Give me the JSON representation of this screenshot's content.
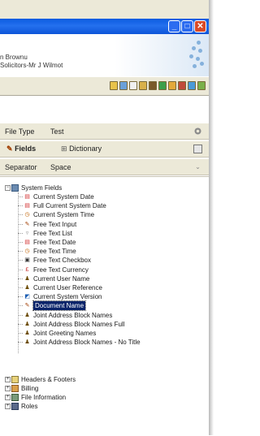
{
  "header": {
    "line1": "n Brownu",
    "line2": "Solicitors-Mr J Wilmot"
  },
  "window_controls": {
    "minimize": "_",
    "maximize": "□",
    "close": "✕"
  },
  "properties": {
    "file_type": {
      "label": "File Type",
      "value": "Test"
    },
    "tabs": [
      {
        "label": "Fields"
      },
      {
        "label": "Dictionary"
      }
    ],
    "separator": {
      "label": "Separator",
      "value": "Space"
    }
  },
  "tree": {
    "root": "System Fields",
    "children": [
      {
        "label": "Current System Date",
        "icon": "calendar-icon",
        "color": "#d32f2f"
      },
      {
        "label": "Full Current System Date",
        "icon": "calendar-icon",
        "color": "#d32f2f"
      },
      {
        "label": "Current System Time",
        "icon": "clock-icon",
        "color": "#c06000"
      },
      {
        "label": "Free Text Input",
        "icon": "pen-icon",
        "color": "#a13d00"
      },
      {
        "label": "Free Text List",
        "icon": "list-icon",
        "color": "#888888"
      },
      {
        "label": "Free Text Date",
        "icon": "calendar-icon",
        "color": "#d32f2f"
      },
      {
        "label": "Free Text Time",
        "icon": "clock-icon",
        "color": "#c06000"
      },
      {
        "label": "Free Text Checkbox",
        "icon": "checkbox-icon",
        "color": "#333333"
      },
      {
        "label": "Free Text Currency",
        "icon": "currency-icon",
        "color": "#c62828"
      },
      {
        "label": "Current User Name",
        "icon": "person-icon",
        "color": "#6b4a00"
      },
      {
        "label": "Current User Reference",
        "icon": "person-icon",
        "color": "#6b4a00"
      },
      {
        "label": "Current System Version",
        "icon": "version-icon",
        "color": "#1e5fb3"
      },
      {
        "label": "Document Name",
        "icon": "pen-icon",
        "color": "#a13d00",
        "selected": true
      },
      {
        "label": "Joint Address Block Names",
        "icon": "person-icon",
        "color": "#6b4a00"
      },
      {
        "label": "Joint Address Block Names Full",
        "icon": "person-icon",
        "color": "#6b4a00"
      },
      {
        "label": "Joint Greeting Names",
        "icon": "person-icon",
        "color": "#6b4a00"
      },
      {
        "label": "Joint Address Block Names - No Title",
        "icon": "person-icon",
        "color": "#6b4a00"
      }
    ],
    "groups": [
      {
        "label": "Headers & Footers",
        "icon": "folder-icon"
      },
      {
        "label": "Billing",
        "icon": "billing-icon"
      },
      {
        "label": "File Information",
        "icon": "file-info-icon"
      },
      {
        "label": "Roles",
        "icon": "roles-icon"
      }
    ]
  }
}
